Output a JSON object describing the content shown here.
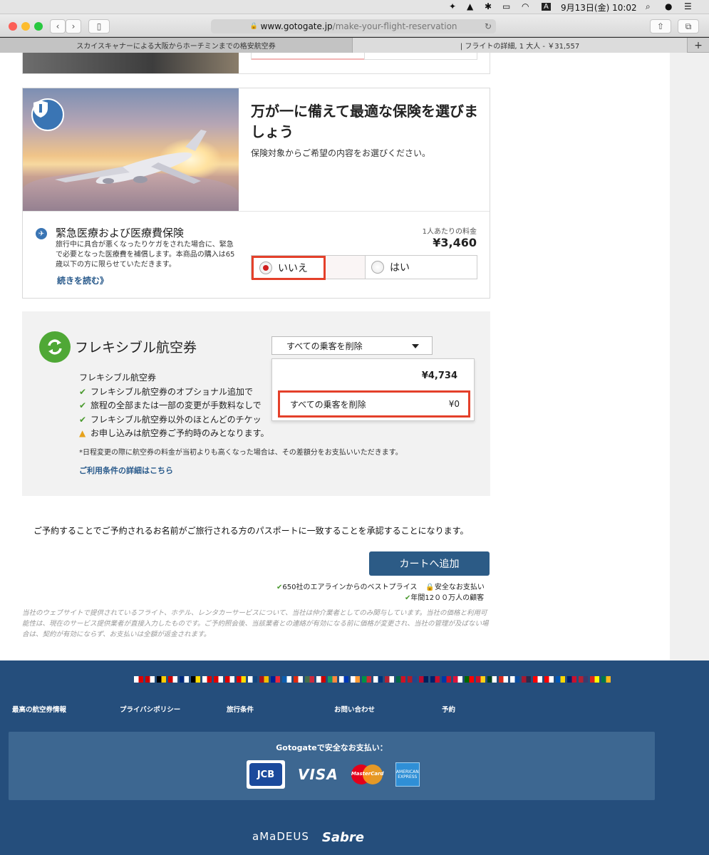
{
  "menubar": {
    "date_time": "9月13日(金)  10:02",
    "input_badge": "A"
  },
  "browser": {
    "url_host": "www.gotogate.jp",
    "url_path": "/make-your-flight-reservation",
    "tabs": [
      {
        "label": "スカイスキャナーによる大阪からホーチミンまでの格安航空券"
      },
      {
        "label": "| フライトの詳細, 1 大人 - ￥31,557"
      }
    ],
    "new_tab": "+"
  },
  "insurance": {
    "title": "万が一に備えて最適な保険を選びましょう",
    "subtitle": "保険対象からご希望の内容をお選びください。",
    "medical_title": "緊急医療および医療費保険",
    "medical_desc": "旅行中に具合が悪くなったりケガをされた場合に、緊急で必要となった医療費を補償します。本商品の購入は65歳以下の方に限らせていただきます。",
    "read_more": "続きを読む》",
    "price_label": "1人あたりの料金",
    "price": "¥3,460",
    "option_no": "いいえ",
    "option_yes": "はい"
  },
  "flex": {
    "title": "フレキシブル航空券",
    "heading": "フレキシブル航空券",
    "bullets": [
      "フレキシブル航空券のオプショナル追加で",
      "旅程の全部または一部の変更が手数料なしで",
      "フレキシブル航空券以外のほとんどのチケッ"
    ],
    "warning": "お申し込みは航空券ご予約時のみとなります。",
    "note": "*日程変更の際に航空券の料金が当初よりも高くなった場合は、その差額分をお支払いいただきます。",
    "terms_link": "ご利用条件の詳細はこちら",
    "select_value": "すべての乗客を削除",
    "dropdown_price": "¥4,734",
    "dropdown_option_label": "すべての乗客を削除",
    "dropdown_option_price": "¥0"
  },
  "consent": "ご予約することでご予約されるお名前がご旅行される方のパスポートに一致することを承認することになります。",
  "cart_button": "カートへ追加",
  "trust": {
    "best_price": "650社のエアラインからのベストプライス",
    "secure": "安全なお支払い",
    "customers": "年間12００万人の顧客"
  },
  "disclaimer": "当社のウェブサイトで提供されているフライト、ホテル、レンタカーサービスについて、当社は仲介業者としてのみ関与しています。当社の価格と利用可能性は、現在のサービス提供業者が直接入力したものです。ご予約照会後、当該業者との連絡が有効になる前に価格が変更され、当社の管理が及ばない場合は、契約が有効にならず、お支払いは全額が返金されます。",
  "footer": {
    "links": [
      "最高の航空券情報",
      "プライバシポリシー",
      "旅行条件",
      "お問い合わせ",
      "予約"
    ],
    "pay_title": "Gotogateで安全なお支払い：",
    "cards": [
      "JCB",
      "VISA",
      "MasterCard",
      "AMERICAN EXPRESS"
    ],
    "brands": [
      "aMaDEUS",
      "Sabre"
    ]
  },
  "colors": {
    "accent_red": "#e4402a",
    "brand_blue": "#2c5b86",
    "footer_bg": "#254e7c",
    "check_green": "#4a9a2e"
  }
}
